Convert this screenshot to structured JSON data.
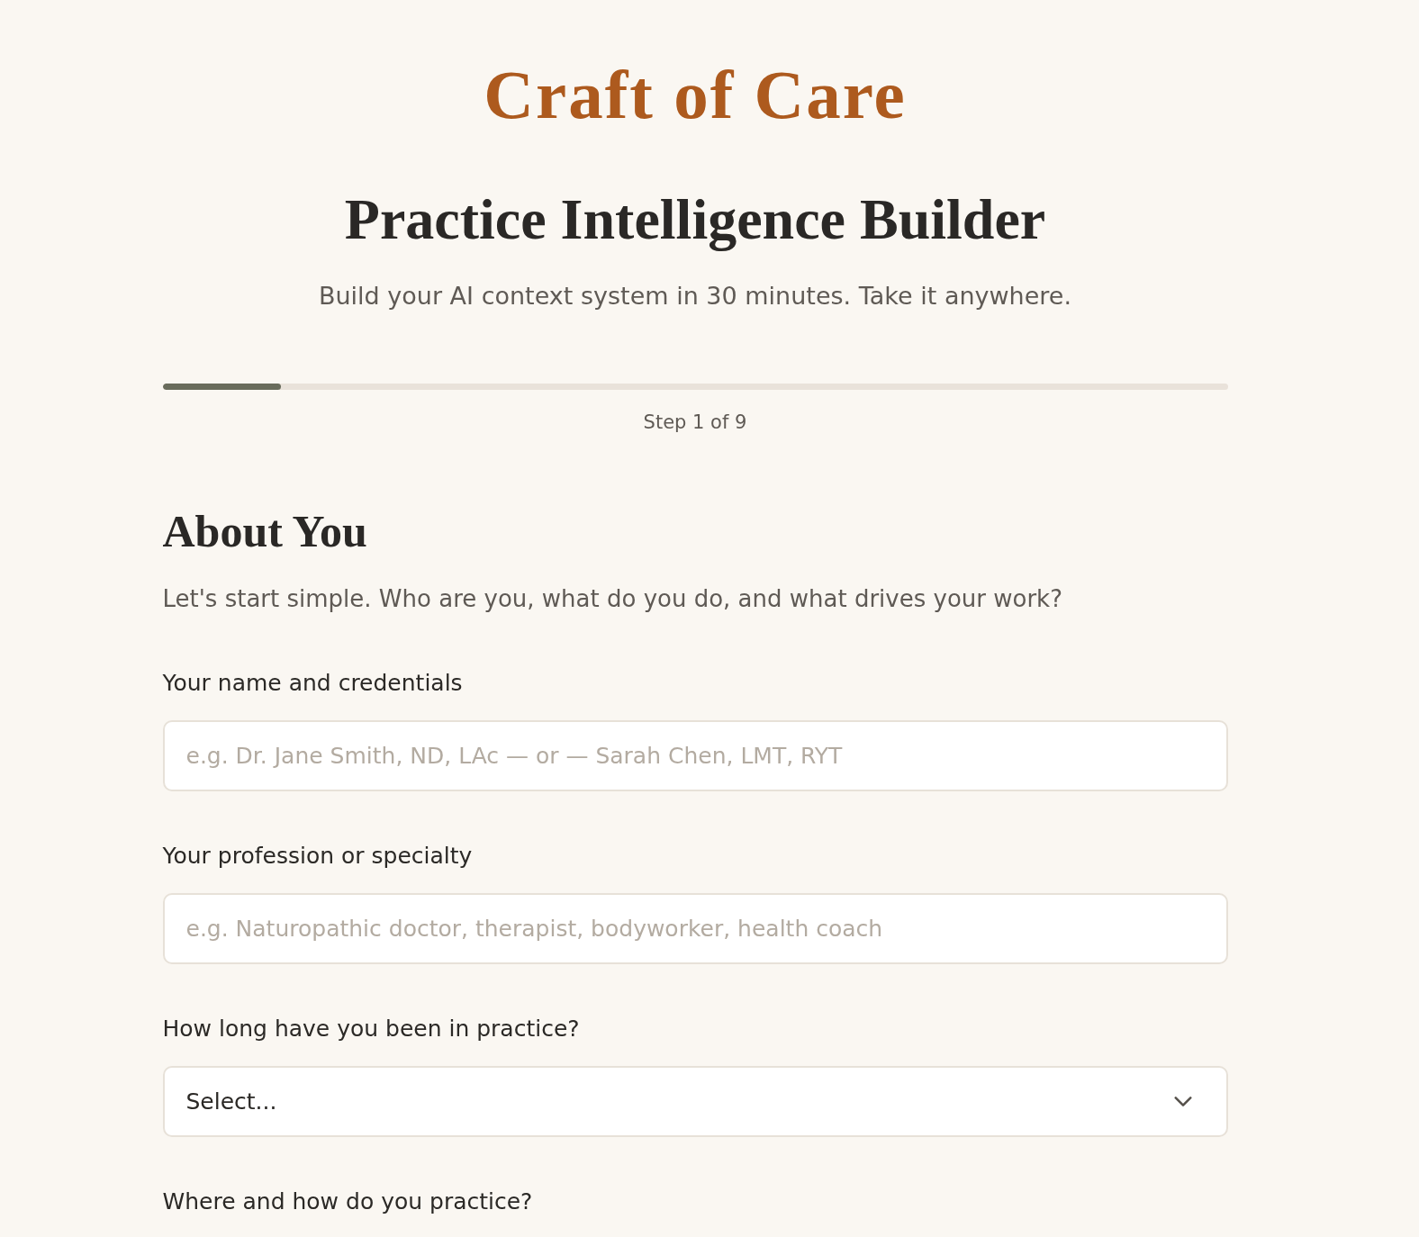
{
  "brand": {
    "title": "Craft of Care"
  },
  "header": {
    "title": "Practice Intelligence Builder",
    "subtitle": "Build your AI context system in 30 minutes. Take it anywhere."
  },
  "progress": {
    "level": 0.111,
    "label": "Step 1 of 9"
  },
  "section": {
    "title": "About You",
    "description": "Let's start simple. Who are you, what do you do, and what drives your work?",
    "fields": [
      {
        "kind": "text",
        "label": "Your name and credentials",
        "placeholder": "e.g. Dr. Jane Smith, ND, LAc — or — Sarah Chen, LMT, RYT"
      },
      {
        "kind": "text",
        "label": "Your profession or specialty",
        "placeholder": "e.g. Naturopathic doctor, therapist, bodyworker, health coach"
      },
      {
        "kind": "select",
        "label": "How long have you been in practice?",
        "value": "Select..."
      },
      {
        "kind": "label",
        "label": "Where and how do you practice?"
      }
    ]
  }
}
